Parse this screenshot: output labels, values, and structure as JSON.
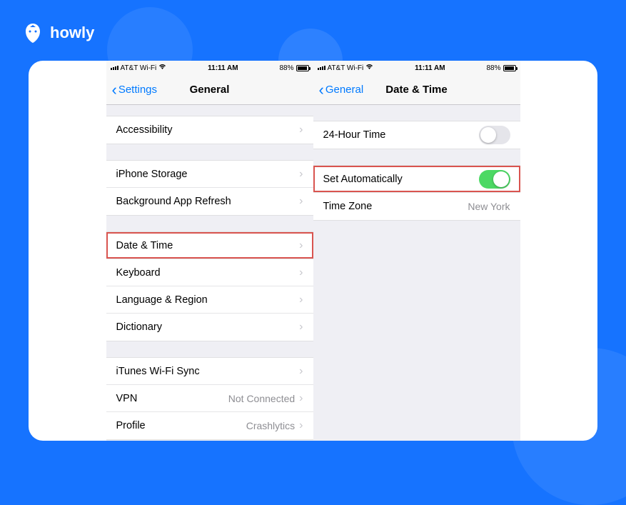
{
  "logo": {
    "name": "howly"
  },
  "status": {
    "carrier": "AT&T Wi-Fi",
    "time": "11:11 AM",
    "battery": "88%"
  },
  "left_screen": {
    "back_label": "Settings",
    "title": "General",
    "rows": {
      "accessibility": "Accessibility",
      "iphone_storage": "iPhone Storage",
      "background_refresh": "Background App Refresh",
      "date_time": "Date & Time",
      "keyboard": "Keyboard",
      "language_region": "Language & Region",
      "dictionary": "Dictionary",
      "itunes_wifi": "iTunes Wi-Fi Sync",
      "vpn": "VPN",
      "vpn_value": "Not Connected",
      "profile": "Profile",
      "profile_value": "Crashlytics"
    }
  },
  "right_screen": {
    "back_label": "General",
    "title": "Date & Time",
    "rows": {
      "hour24": "24-Hour Time",
      "set_auto": "Set Automatically",
      "time_zone": "Time Zone",
      "tz_value": "New York"
    }
  }
}
